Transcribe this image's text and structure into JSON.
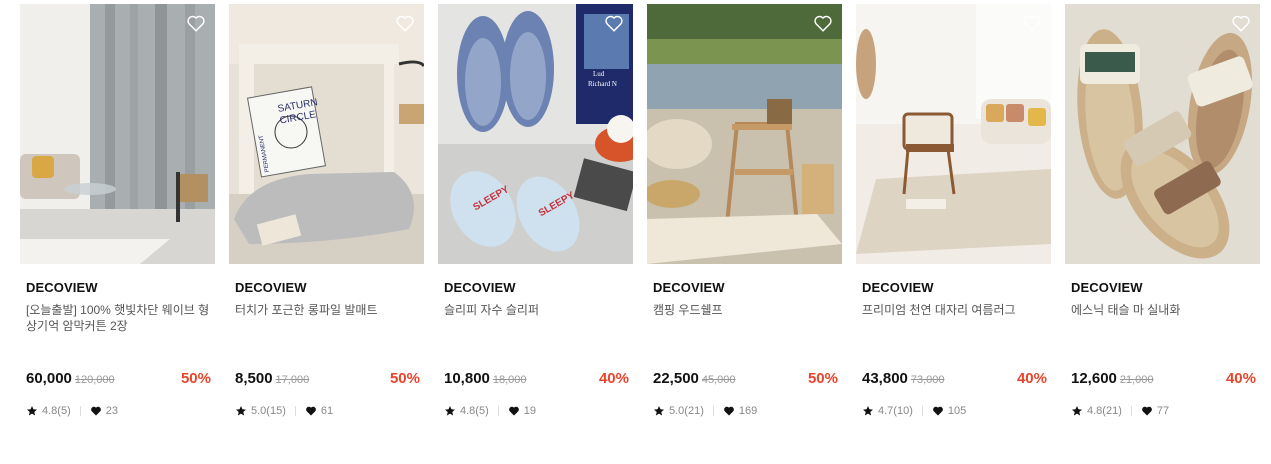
{
  "products": [
    {
      "brand": "DECOVIEW",
      "title": "[오늘출발] 100% 햇빛차단 웨이브 형상기억 암막커튼 2장",
      "price": "60,000",
      "original_price": "120,000",
      "discount": "50%",
      "rating": "4.8(5)",
      "likes": "23",
      "image": "living-room-curtain"
    },
    {
      "brand": "DECOVIEW",
      "title": "터치가 포근한 롱파일 발매트",
      "price": "8,500",
      "original_price": "17,000",
      "discount": "50%",
      "rating": "5.0(15)",
      "likes": "61",
      "image": "bath-mat-saturn-circle"
    },
    {
      "brand": "DECOVIEW",
      "title": "슬리피 자수 슬리퍼",
      "price": "10,800",
      "original_price": "18,000",
      "discount": "40%",
      "rating": "4.8(5)",
      "likes": "19",
      "image": "sleepy-slippers"
    },
    {
      "brand": "DECOVIEW",
      "title": "캠핑 우드쉘프",
      "price": "22,500",
      "original_price": "45,000",
      "discount": "50%",
      "rating": "5.0(21)",
      "likes": "169",
      "image": "camping-wood-shelf"
    },
    {
      "brand": "DECOVIEW",
      "title": "프리미엄 천연 대자리 여름러그",
      "price": "43,800",
      "original_price": "73,000",
      "discount": "40%",
      "rating": "4.7(10)",
      "likes": "105",
      "image": "summer-rug"
    },
    {
      "brand": "DECOVIEW",
      "title": "에스닉 태슬 마 실내화",
      "price": "12,600",
      "original_price": "21,000",
      "discount": "40%",
      "rating": "4.8(21)",
      "likes": "77",
      "image": "ethnic-tassel-slippers"
    }
  ],
  "colors": {
    "discount": "#e8452c",
    "original_price": "#999999",
    "meta_text": "#888888"
  },
  "icons": {
    "wishlist": "heart-outline-icon",
    "rating": "star-icon",
    "likes": "heart-filled-icon"
  },
  "image_text": {
    "saturn_line1": "SATURN",
    "saturn_line2": "CIRCLE",
    "saturn_side": "PERMANENT",
    "slipper_text": "SLEEPY",
    "book_line1": "Lud",
    "book_line2": "Richard N"
  }
}
